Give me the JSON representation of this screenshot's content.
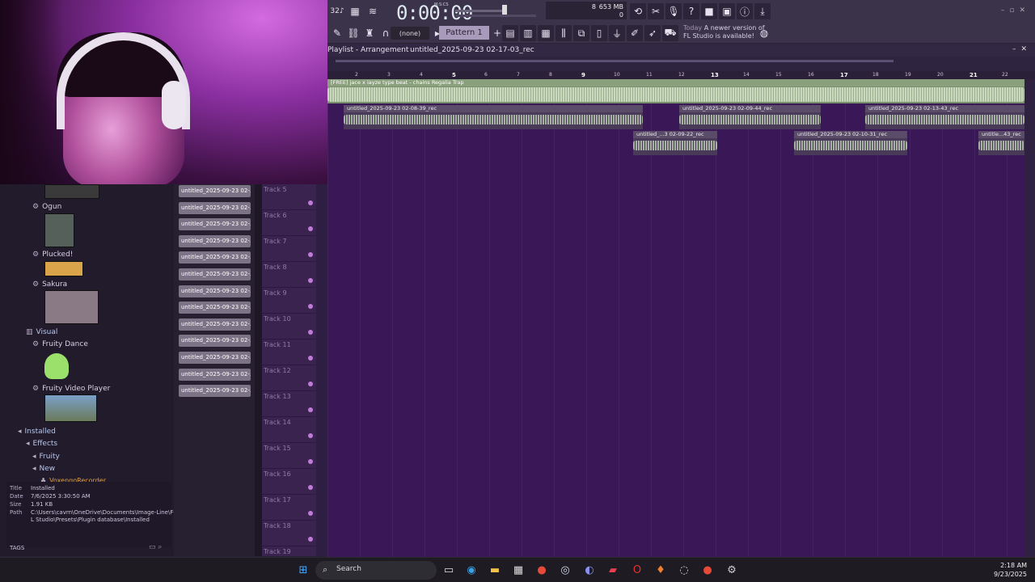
{
  "toolbar": {
    "time": "0:00:00",
    "time_units": "M:S:CS",
    "cpu_polyphony": "8",
    "ram": "653 MB",
    "ram_sub": "0",
    "pattern_none": "(none)",
    "pattern_name": "Pattern 1",
    "news_today": "Today",
    "news_text_1": "A newer version of",
    "news_text_2": "FL Studio is available!"
  },
  "playlist": {
    "title": "Playlist - Arrangement",
    "file": "untitled_2025-09-23 02-17-03_rec",
    "ruler": [
      "2",
      "3",
      "4",
      "5",
      "6",
      "7",
      "8",
      "9",
      "10",
      "11",
      "12",
      "13",
      "14",
      "15",
      "16",
      "17",
      "18",
      "19",
      "20",
      "21",
      "22"
    ],
    "beat_clip": "[FREE] jace x iayze type beat - chains  Regalia Trap",
    "clips_row2": [
      "untitled_2025-09-23 02-08-39_rec",
      "untitled_2025-09-23 02-09-44_rec",
      "untitled_2025-09-23 02-13-43_rec"
    ],
    "clips_row3": [
      "untitled_...3 02-09-22_rec",
      "untitled_2025-09-23 02-10-31_rec",
      "untitle...43_rec"
    ]
  },
  "tracks": [
    "Track 5",
    "Track 6",
    "Track 7",
    "Track 8",
    "Track 9",
    "Track 10",
    "Track 11",
    "Track 12",
    "Track 13",
    "Track 14",
    "Track 15",
    "Track 16",
    "Track 17",
    "Track 18",
    "Track 19"
  ],
  "recorded": [
    "untitled_2025-09-23 02-...",
    "untitled_2025-09-23 02-...",
    "untitled_2025-09-23 02-...",
    "untitled_2025-09-23 02-...",
    "untitled_2025-09-23 02-...",
    "untitled_2025-09-23 02-...",
    "untitled_2025-09-23 02-...",
    "untitled_2025-09-23 02-...",
    "untitled_2025-09-23 02-...",
    "untitled_2025-09-23 02-...",
    "untitled_2025-09-23 02-...",
    "untitled_2025-09-23 02-...",
    "untitled_2025-09-23 02-..."
  ],
  "browser": {
    "ogun": "Ogun",
    "plucked": "Plucked!",
    "sakura": "Sakura",
    "visual": "Visual",
    "fruity_dance": "Fruity Dance",
    "fruity_video": "Fruity Video Player",
    "installed": "Installed",
    "effects": "Effects",
    "fruity": "Fruity",
    "new": "New",
    "voxengo": "VoxengoRecorder"
  },
  "info": {
    "title_k": "Title",
    "title_v": "Installed",
    "date_k": "Date",
    "date_v": "7/6/2025 3:30:50 AM",
    "size_k": "Size",
    "size_v": "1.91 KB",
    "path_k": "Path",
    "path_v1": "C:\\Users\\cavrn\\OneDrive\\Documents\\Image-Line\\F-",
    "path_v2": "L Studio\\Presets\\Plugin database\\Installed",
    "tags": "TAGS"
  },
  "taskbar": {
    "search": "Search",
    "time": "2:18 AM",
    "date": "9/23/2025"
  }
}
